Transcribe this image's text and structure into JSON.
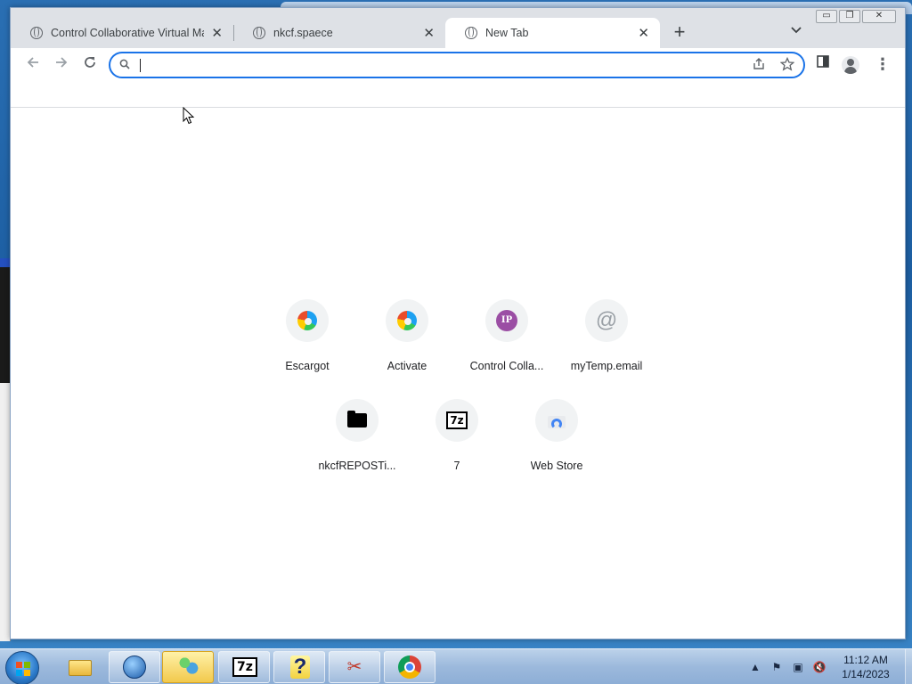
{
  "browser": {
    "tabs": [
      {
        "title": "Control Collaborative Virtual Ma",
        "active": false
      },
      {
        "title": "nkcf.spaece",
        "active": false
      },
      {
        "title": "New Tab",
        "active": true
      }
    ],
    "new_tab_symbol": "+",
    "tab_close_symbol": "✕",
    "omnibox": {
      "value": "",
      "placeholder": ""
    },
    "window_controls": {
      "minimize": "▭",
      "restore": "❐",
      "close": "✕"
    }
  },
  "new_tab_page": {
    "shortcuts": [
      {
        "label": "Escargot",
        "icon": "edge-icon"
      },
      {
        "label": "Activate",
        "icon": "edge-icon"
      },
      {
        "label": "Control Colla...",
        "icon": "ip-icon",
        "icon_text": "IP"
      },
      {
        "label": "myTemp.email",
        "icon": "at-icon",
        "icon_text": "@"
      },
      {
        "label": "nkcfREPOSTi...",
        "icon": "folder-icon"
      },
      {
        "label": "7",
        "icon": "7zip-icon",
        "icon_text": "7z"
      },
      {
        "label": "Web Store",
        "icon": "webstore-icon"
      }
    ]
  },
  "taskbar": {
    "apps": [
      {
        "name": "windows-explorer"
      },
      {
        "name": "browser-globe"
      },
      {
        "name": "people-app",
        "active": true
      },
      {
        "name": "7zip",
        "icon_text": "7z"
      },
      {
        "name": "help",
        "icon_text": "?"
      },
      {
        "name": "snipping-tool"
      },
      {
        "name": "chrome"
      }
    ],
    "clock": {
      "time": "11:12 AM",
      "date": "1/14/2023"
    }
  },
  "colors": {
    "omnibox_border": "#1a73e8",
    "tabstrip_bg": "#dee1e6",
    "ip_icon_bg": "#9b4ea4"
  }
}
